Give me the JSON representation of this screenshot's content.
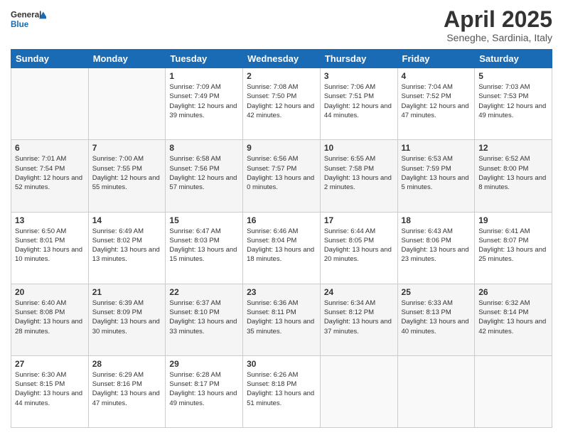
{
  "logo": {
    "line1": "General",
    "line2": "Blue"
  },
  "title": "April 2025",
  "subtitle": "Seneghe, Sardinia, Italy",
  "days_of_week": [
    "Sunday",
    "Monday",
    "Tuesday",
    "Wednesday",
    "Thursday",
    "Friday",
    "Saturday"
  ],
  "weeks": [
    [
      {
        "day": "",
        "sunrise": "",
        "sunset": "",
        "daylight": ""
      },
      {
        "day": "",
        "sunrise": "",
        "sunset": "",
        "daylight": ""
      },
      {
        "day": "1",
        "sunrise": "Sunrise: 7:09 AM",
        "sunset": "Sunset: 7:49 PM",
        "daylight": "Daylight: 12 hours and 39 minutes."
      },
      {
        "day": "2",
        "sunrise": "Sunrise: 7:08 AM",
        "sunset": "Sunset: 7:50 PM",
        "daylight": "Daylight: 12 hours and 42 minutes."
      },
      {
        "day": "3",
        "sunrise": "Sunrise: 7:06 AM",
        "sunset": "Sunset: 7:51 PM",
        "daylight": "Daylight: 12 hours and 44 minutes."
      },
      {
        "day": "4",
        "sunrise": "Sunrise: 7:04 AM",
        "sunset": "Sunset: 7:52 PM",
        "daylight": "Daylight: 12 hours and 47 minutes."
      },
      {
        "day": "5",
        "sunrise": "Sunrise: 7:03 AM",
        "sunset": "Sunset: 7:53 PM",
        "daylight": "Daylight: 12 hours and 49 minutes."
      }
    ],
    [
      {
        "day": "6",
        "sunrise": "Sunrise: 7:01 AM",
        "sunset": "Sunset: 7:54 PM",
        "daylight": "Daylight: 12 hours and 52 minutes."
      },
      {
        "day": "7",
        "sunrise": "Sunrise: 7:00 AM",
        "sunset": "Sunset: 7:55 PM",
        "daylight": "Daylight: 12 hours and 55 minutes."
      },
      {
        "day": "8",
        "sunrise": "Sunrise: 6:58 AM",
        "sunset": "Sunset: 7:56 PM",
        "daylight": "Daylight: 12 hours and 57 minutes."
      },
      {
        "day": "9",
        "sunrise": "Sunrise: 6:56 AM",
        "sunset": "Sunset: 7:57 PM",
        "daylight": "Daylight: 13 hours and 0 minutes."
      },
      {
        "day": "10",
        "sunrise": "Sunrise: 6:55 AM",
        "sunset": "Sunset: 7:58 PM",
        "daylight": "Daylight: 13 hours and 2 minutes."
      },
      {
        "day": "11",
        "sunrise": "Sunrise: 6:53 AM",
        "sunset": "Sunset: 7:59 PM",
        "daylight": "Daylight: 13 hours and 5 minutes."
      },
      {
        "day": "12",
        "sunrise": "Sunrise: 6:52 AM",
        "sunset": "Sunset: 8:00 PM",
        "daylight": "Daylight: 13 hours and 8 minutes."
      }
    ],
    [
      {
        "day": "13",
        "sunrise": "Sunrise: 6:50 AM",
        "sunset": "Sunset: 8:01 PM",
        "daylight": "Daylight: 13 hours and 10 minutes."
      },
      {
        "day": "14",
        "sunrise": "Sunrise: 6:49 AM",
        "sunset": "Sunset: 8:02 PM",
        "daylight": "Daylight: 13 hours and 13 minutes."
      },
      {
        "day": "15",
        "sunrise": "Sunrise: 6:47 AM",
        "sunset": "Sunset: 8:03 PM",
        "daylight": "Daylight: 13 hours and 15 minutes."
      },
      {
        "day": "16",
        "sunrise": "Sunrise: 6:46 AM",
        "sunset": "Sunset: 8:04 PM",
        "daylight": "Daylight: 13 hours and 18 minutes."
      },
      {
        "day": "17",
        "sunrise": "Sunrise: 6:44 AM",
        "sunset": "Sunset: 8:05 PM",
        "daylight": "Daylight: 13 hours and 20 minutes."
      },
      {
        "day": "18",
        "sunrise": "Sunrise: 6:43 AM",
        "sunset": "Sunset: 8:06 PM",
        "daylight": "Daylight: 13 hours and 23 minutes."
      },
      {
        "day": "19",
        "sunrise": "Sunrise: 6:41 AM",
        "sunset": "Sunset: 8:07 PM",
        "daylight": "Daylight: 13 hours and 25 minutes."
      }
    ],
    [
      {
        "day": "20",
        "sunrise": "Sunrise: 6:40 AM",
        "sunset": "Sunset: 8:08 PM",
        "daylight": "Daylight: 13 hours and 28 minutes."
      },
      {
        "day": "21",
        "sunrise": "Sunrise: 6:39 AM",
        "sunset": "Sunset: 8:09 PM",
        "daylight": "Daylight: 13 hours and 30 minutes."
      },
      {
        "day": "22",
        "sunrise": "Sunrise: 6:37 AM",
        "sunset": "Sunset: 8:10 PM",
        "daylight": "Daylight: 13 hours and 33 minutes."
      },
      {
        "day": "23",
        "sunrise": "Sunrise: 6:36 AM",
        "sunset": "Sunset: 8:11 PM",
        "daylight": "Daylight: 13 hours and 35 minutes."
      },
      {
        "day": "24",
        "sunrise": "Sunrise: 6:34 AM",
        "sunset": "Sunset: 8:12 PM",
        "daylight": "Daylight: 13 hours and 37 minutes."
      },
      {
        "day": "25",
        "sunrise": "Sunrise: 6:33 AM",
        "sunset": "Sunset: 8:13 PM",
        "daylight": "Daylight: 13 hours and 40 minutes."
      },
      {
        "day": "26",
        "sunrise": "Sunrise: 6:32 AM",
        "sunset": "Sunset: 8:14 PM",
        "daylight": "Daylight: 13 hours and 42 minutes."
      }
    ],
    [
      {
        "day": "27",
        "sunrise": "Sunrise: 6:30 AM",
        "sunset": "Sunset: 8:15 PM",
        "daylight": "Daylight: 13 hours and 44 minutes."
      },
      {
        "day": "28",
        "sunrise": "Sunrise: 6:29 AM",
        "sunset": "Sunset: 8:16 PM",
        "daylight": "Daylight: 13 hours and 47 minutes."
      },
      {
        "day": "29",
        "sunrise": "Sunrise: 6:28 AM",
        "sunset": "Sunset: 8:17 PM",
        "daylight": "Daylight: 13 hours and 49 minutes."
      },
      {
        "day": "30",
        "sunrise": "Sunrise: 6:26 AM",
        "sunset": "Sunset: 8:18 PM",
        "daylight": "Daylight: 13 hours and 51 minutes."
      },
      {
        "day": "",
        "sunrise": "",
        "sunset": "",
        "daylight": ""
      },
      {
        "day": "",
        "sunrise": "",
        "sunset": "",
        "daylight": ""
      },
      {
        "day": "",
        "sunrise": "",
        "sunset": "",
        "daylight": ""
      }
    ]
  ],
  "accent_color": "#1a6bb5"
}
